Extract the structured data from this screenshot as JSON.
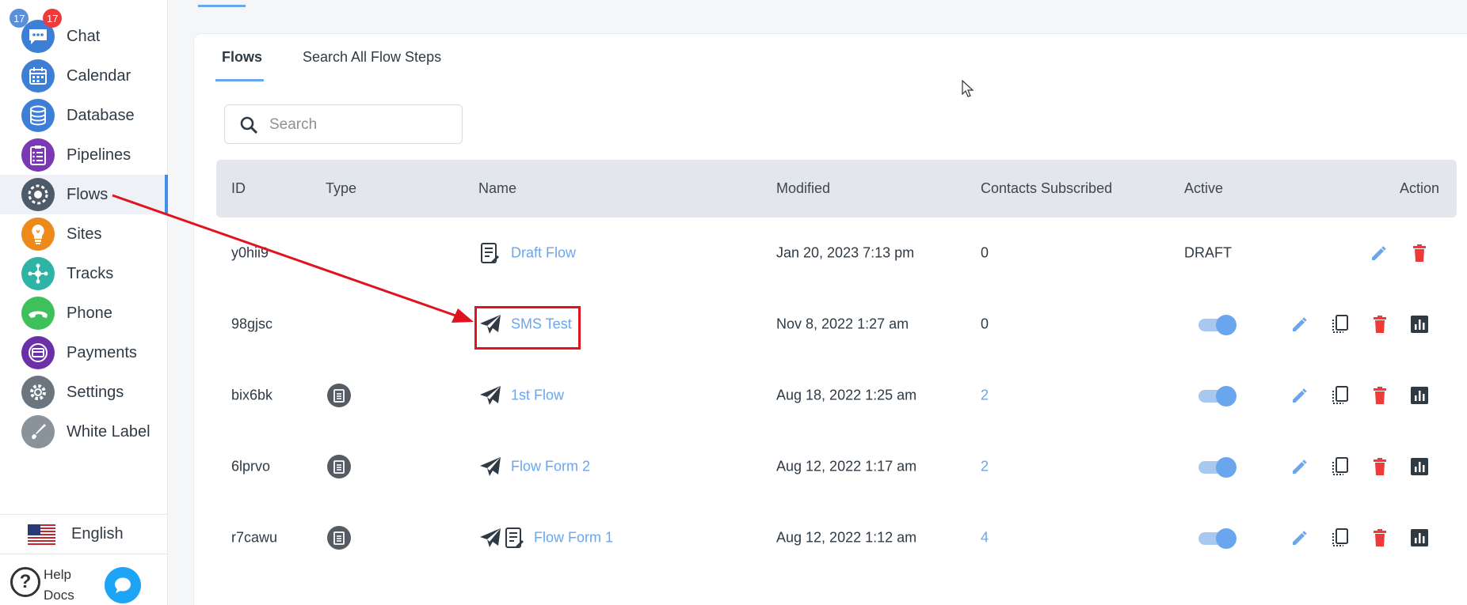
{
  "sidebar": {
    "badges": {
      "blue": "17",
      "red": "17"
    },
    "items": [
      {
        "label": "Chat",
        "icon": "chat-icon",
        "color": "#3d7fd6"
      },
      {
        "label": "Calendar",
        "icon": "calendar-icon",
        "color": "#3d7fd6"
      },
      {
        "label": "Database",
        "icon": "database-icon",
        "color": "#3d7fd6"
      },
      {
        "label": "Pipelines",
        "icon": "pipelines-icon",
        "color": "#7a38b3"
      },
      {
        "label": "Flows",
        "icon": "flows-icon",
        "color": "#4d5a68"
      },
      {
        "label": "Sites",
        "icon": "sites-icon",
        "color": "#ee8a1c"
      },
      {
        "label": "Tracks",
        "icon": "tracks-icon",
        "color": "#2eb3a5"
      },
      {
        "label": "Phone",
        "icon": "phone-icon",
        "color": "#3ec15b"
      },
      {
        "label": "Payments",
        "icon": "payments-icon",
        "color": "#6b2fa8"
      },
      {
        "label": "Settings",
        "icon": "settings-icon",
        "color": "#6b7580"
      },
      {
        "label": "White Label",
        "icon": "white-label-icon",
        "color": "#8a939c"
      }
    ],
    "language": "English",
    "help": "Help Docs"
  },
  "tabs": {
    "flows": "Flows",
    "search_steps": "Search All Flow Steps"
  },
  "search": {
    "placeholder": "Search"
  },
  "table": {
    "headers": {
      "id": "ID",
      "type": "Type",
      "name": "Name",
      "modified": "Modified",
      "contacts": "Contacts Subscribed",
      "active": "Active",
      "action": "Action"
    },
    "rows": [
      {
        "id": "y0hii9",
        "name": "Draft Flow",
        "modified": "Jan 20, 2023 7:13 pm",
        "contacts": "0",
        "active": "DRAFT"
      },
      {
        "id": "98gjsc",
        "name": "SMS Test",
        "modified": "Nov 8, 2022 1:27 am",
        "contacts": "0"
      },
      {
        "id": "bix6bk",
        "name": "1st Flow",
        "modified": "Aug 18, 2022 1:25 am",
        "contacts": "2"
      },
      {
        "id": "6lprvo",
        "name": "Flow Form 2",
        "modified": "Aug 12, 2022 1:17 am",
        "contacts": "2"
      },
      {
        "id": "r7cawu",
        "name": "Flow Form 1",
        "modified": "Aug 12, 2022 1:12 am",
        "contacts": "4"
      }
    ]
  },
  "colors": {
    "accent": "#6aa6ee",
    "delete": "#ef3a3a",
    "annotation": "#e0141e"
  }
}
